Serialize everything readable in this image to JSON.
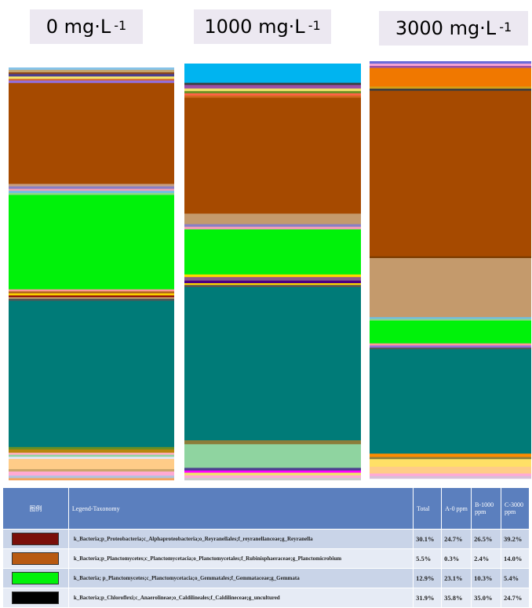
{
  "headers": [
    {
      "text": "0 mg·L",
      "sup": "-1"
    },
    {
      "text": "1000 mg·L",
      "sup": "-1"
    },
    {
      "text": "3000 mg·L",
      "sup": "-1"
    }
  ],
  "chart_data": {
    "type": "bar",
    "stacked": "100%",
    "categories": [
      "0 mg·L -1",
      "1000 mg·L -1",
      "3000 mg·L -1"
    ],
    "series": [
      {
        "name": "k_Bacteria;p_Proteobacteria;c_Alphaproteobacteria;o_Reyranellales;f_reyranellanceae;g_Reyranella",
        "color": "#7a0f0a",
        "values": [
          24.7,
          26.5,
          39.2
        ]
      },
      {
        "name": "k_Bacteria;p_Planctomycetes;c_Planctomycetacia;o_Planctomycetales;f_Rubinisphaeraceae;g_Planctomicrobium",
        "color": "#b85a12",
        "values": [
          0.3,
          2.4,
          14.0
        ]
      },
      {
        "name": "k_Bacteria; p_Planctomycetes;c_Planctomycetacia;o_Gemmatales;f_Gemmataceae;g_Gemmata",
        "color": "#00f20a",
        "values": [
          23.1,
          10.3,
          5.4
        ]
      },
      {
        "name": "k_Bacteria;p_Chloroflexi;c_Anaerolineae;o_Caldilineales;f_Caldilineceae;g_uncultured",
        "color": "#000000",
        "values": [
          35.8,
          35.0,
          24.7
        ]
      }
    ],
    "segments": [
      [
        {
          "color": "#86c3e8",
          "value": 0.6
        },
        {
          "color": "#c4a36b",
          "value": 0.6
        },
        {
          "color": "#8b4513",
          "value": 0.4
        },
        {
          "color": "#4b3f8f",
          "value": 0.6
        },
        {
          "color": "#f0e36b",
          "value": 0.6
        },
        {
          "color": "#d55e2b",
          "value": 0.4
        },
        {
          "color": "#9370db",
          "value": 0.6
        },
        {
          "color": "#a64a00",
          "value": 24.7
        },
        {
          "color": "#c89f82",
          "value": 0.6
        },
        {
          "color": "#8a7fc4",
          "value": 0.6
        },
        {
          "color": "#f29fb5",
          "value": 0.5
        },
        {
          "color": "#6bbfe8",
          "value": 0.5
        },
        {
          "color": "#8fd48a",
          "value": 0.5
        },
        {
          "color": "#00f20a",
          "value": 23.1
        },
        {
          "color": "#ff9999",
          "value": 0.5
        },
        {
          "color": "#b5651d",
          "value": 0.5
        },
        {
          "color": "#ffd700",
          "value": 0.5
        },
        {
          "color": "#8b0000",
          "value": 0.4
        },
        {
          "color": "#c4a36b",
          "value": 0.4
        },
        {
          "color": "#555555",
          "value": 0.5
        },
        {
          "color": "#007b78",
          "value": 35.8
        },
        {
          "color": "#6b8e23",
          "value": 0.6
        },
        {
          "color": "#b8860b",
          "value": 0.8
        },
        {
          "color": "#ffb0c0",
          "value": 0.5
        },
        {
          "color": "#8fd4a0",
          "value": 0.5
        },
        {
          "color": "#e6e6fa",
          "value": 0.5
        },
        {
          "color": "#ffcc88",
          "value": 2.5
        },
        {
          "color": "#cba56a",
          "value": 0.6
        },
        {
          "color": "#ffaad4",
          "value": 1.0
        },
        {
          "color": "#b0c4de",
          "value": 0.6
        },
        {
          "color": "#f4a460",
          "value": 0.5
        }
      ],
      [
        {
          "color": "#00b4f0",
          "value": 4.4
        },
        {
          "color": "#3d3d3d",
          "value": 0.5
        },
        {
          "color": "#9b4fa6",
          "value": 0.8
        },
        {
          "color": "#f0e36b",
          "value": 0.6
        },
        {
          "color": "#6b8e23",
          "value": 0.5
        },
        {
          "color": "#ff6347",
          "value": 0.5
        },
        {
          "color": "#d2691e",
          "value": 0.5
        },
        {
          "color": "#a64a00",
          "value": 26.5
        },
        {
          "color": "#c49a6c",
          "value": 2.4
        },
        {
          "color": "#8a7fc4",
          "value": 0.6
        },
        {
          "color": "#f29fb5",
          "value": 0.6
        },
        {
          "color": "#00f20a",
          "value": 10.3
        },
        {
          "color": "#ffd700",
          "value": 0.6
        },
        {
          "color": "#8b5a8b",
          "value": 0.8
        },
        {
          "color": "#4b0082",
          "value": 0.6
        },
        {
          "color": "#ffd700",
          "value": 0.4
        },
        {
          "color": "#555555",
          "value": 0.5
        },
        {
          "color": "#007b78",
          "value": 35.0
        },
        {
          "color": "#8b7d3a",
          "value": 0.9
        },
        {
          "color": "#8fd4a0",
          "value": 5.4
        },
        {
          "color": "#4b3f8f",
          "value": 0.6
        },
        {
          "color": "#ff00ff",
          "value": 0.5
        },
        {
          "color": "#f0e36b",
          "value": 0.6
        },
        {
          "color": "#ffaad4",
          "value": 0.6
        },
        {
          "color": "#cccccc",
          "value": 0.5
        }
      ],
      [
        {
          "color": "#6b6bd8",
          "value": 0.6
        },
        {
          "color": "#ffaad4",
          "value": 0.5
        },
        {
          "color": "#9b4fa6",
          "value": 0.5
        },
        {
          "color": "#f07800",
          "value": 4.4
        },
        {
          "color": "#d4a017",
          "value": 0.5
        },
        {
          "color": "#3d3d3d",
          "value": 0.5
        },
        {
          "color": "#a64a00",
          "value": 39.2
        },
        {
          "color": "#7a3b00",
          "value": 0.4
        },
        {
          "color": "#c49a6c",
          "value": 14.0
        },
        {
          "color": "#6bbfe8",
          "value": 0.4
        },
        {
          "color": "#8fd48a",
          "value": 0.4
        },
        {
          "color": "#00f20a",
          "value": 5.4
        },
        {
          "color": "#ff9999",
          "value": 0.5
        },
        {
          "color": "#9370db",
          "value": 0.5
        },
        {
          "color": "#555555",
          "value": 0.4
        },
        {
          "color": "#007b78",
          "value": 24.7
        },
        {
          "color": "#ff8c00",
          "value": 0.8
        },
        {
          "color": "#8b7d3a",
          "value": 0.5
        },
        {
          "color": "#ffe066",
          "value": 1.8
        },
        {
          "color": "#ffcc88",
          "value": 1.6
        },
        {
          "color": "#ffaad4",
          "value": 0.6
        },
        {
          "color": "#d8bfd8",
          "value": 0.6
        }
      ]
    ]
  },
  "legend": {
    "header": {
      "icon": "图例",
      "taxonomy": "Legend-Taxonomy",
      "total": "Total",
      "a": "A-0 ppm",
      "b": "B-1000 ppm",
      "c": "C-3000 ppm"
    },
    "rows": [
      {
        "color": "#7a0f0a",
        "taxonomy": "k_Bacteria;p_Proteobacteria;c_Alphaproteobacteria;o_Reyranellales;f_reyranellanceae;g_Reyranella",
        "total": "30.1%",
        "a": "24.7%",
        "b": "26.5%",
        "c": "39.2%"
      },
      {
        "color": "#b85a12",
        "taxonomy": "k_Bacteria;p_Planctomycetes;c_Planctomycetacia;o_Planctomycetales;f_Rubinisphaeraceae;g_Planctomicrobium",
        "total": "5.5%",
        "a": "0.3%",
        "b": "2.4%",
        "c": "14.0%"
      },
      {
        "color": "#00f20a",
        "taxonomy": "k_Bacteria; p_Planctomycetes;c_Planctomycetacia;o_Gemmatales;f_Gemmataceae;g_Gemmata",
        "total": "12.9%",
        "a": "23.1%",
        "b": "10.3%",
        "c": "5.4%"
      },
      {
        "color": "#000000",
        "taxonomy": "k_Bacteria;p_Chloroflexi;c_Anaerolineae;o_Caldilineales;f_Caldilineceae;g_uncultured",
        "total": "31.9%",
        "a": "35.8%",
        "b": "35.0%",
        "c": "24.7%"
      }
    ]
  }
}
